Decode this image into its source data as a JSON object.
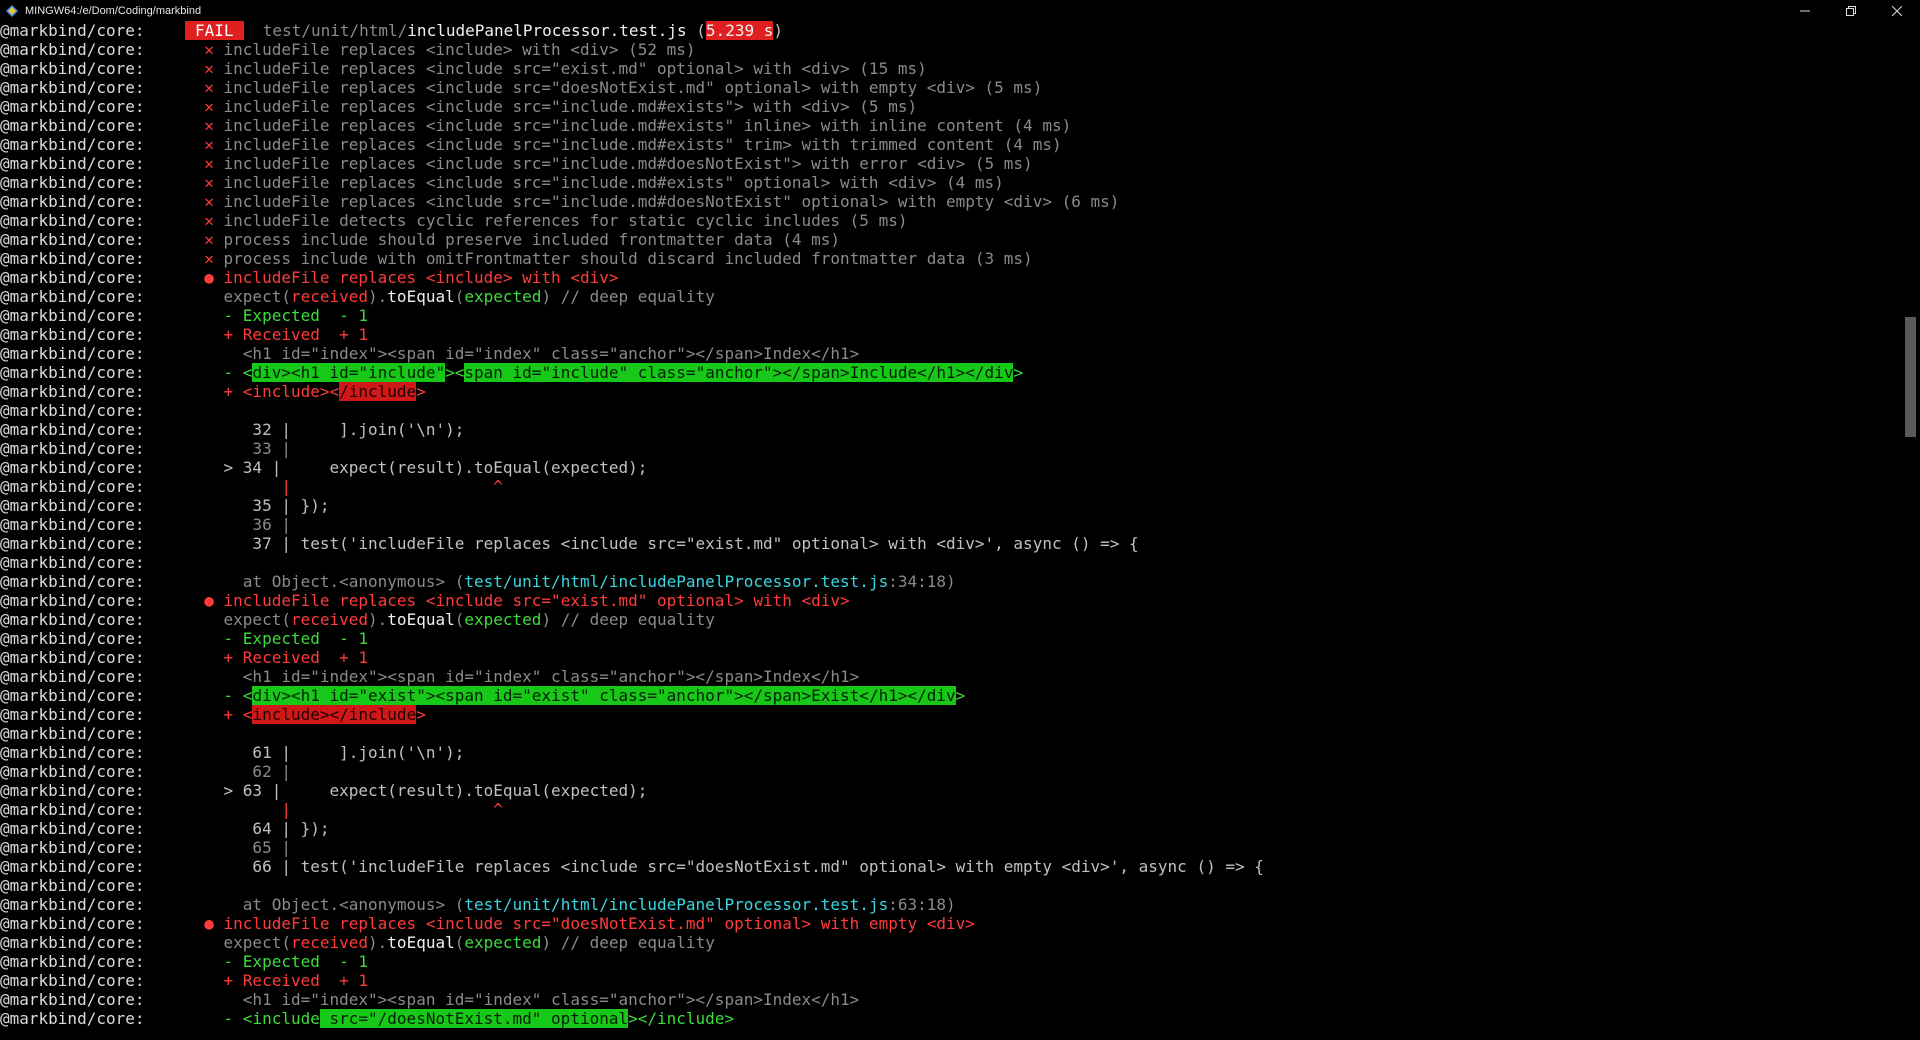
{
  "window": {
    "title": "MINGW64:/e/Dom/Coding/markbind"
  },
  "colors": {
    "default": "#c0c0c0",
    "dim": "#8a8a8a",
    "red": "#ff3b3b",
    "green": "#3ddc3d",
    "yellow": "#e8e84a",
    "cyan": "#3ad6e0",
    "white": "#f0f0f0",
    "badge_red": "#e02020",
    "hl_green": "#18c818",
    "hl_red": "#d01818"
  },
  "prefix": "@markbind/core:",
  "lines": [
    [
      [
        "FAIL",
        "badge"
      ],
      [
        "  test/unit/html/",
        "dim"
      ],
      [
        "includePanelProcessor.test.js",
        "white"
      ],
      [
        " (",
        "default"
      ],
      [
        "5.239 s",
        "redbadge"
      ],
      [
        ")",
        "default"
      ]
    ],
    [
      [
        "  ✕ ",
        "red"
      ],
      [
        "includeFile replaces <include> with <div> (52 ms)",
        "dim"
      ]
    ],
    [
      [
        "  ✕ ",
        "red"
      ],
      [
        "includeFile replaces <include src=\"exist.md\" optional> with <div> (15 ms)",
        "dim"
      ]
    ],
    [
      [
        "  ✕ ",
        "red"
      ],
      [
        "includeFile replaces <include src=\"doesNotExist.md\" optional> with empty <div> (5 ms)",
        "dim"
      ]
    ],
    [
      [
        "  ✕ ",
        "red"
      ],
      [
        "includeFile replaces <include src=\"include.md#exists\"> with <div> (5 ms)",
        "dim"
      ]
    ],
    [
      [
        "  ✕ ",
        "red"
      ],
      [
        "includeFile replaces <include src=\"include.md#exists\" inline> with inline content (4 ms)",
        "dim"
      ]
    ],
    [
      [
        "  ✕ ",
        "red"
      ],
      [
        "includeFile replaces <include src=\"include.md#exists\" trim> with trimmed content (4 ms)",
        "dim"
      ]
    ],
    [
      [
        "  ✕ ",
        "red"
      ],
      [
        "includeFile replaces <include src=\"include.md#doesNotExist\"> with error <div> (5 ms)",
        "dim"
      ]
    ],
    [
      [
        "  ✕ ",
        "red"
      ],
      [
        "includeFile replaces <include src=\"include.md#exists\" optional> with <div> (4 ms)",
        "dim"
      ]
    ],
    [
      [
        "  ✕ ",
        "red"
      ],
      [
        "includeFile replaces <include src=\"include.md#doesNotExist\" optional> with empty <div> (6 ms)",
        "dim"
      ]
    ],
    [
      [
        "  ✕ ",
        "red"
      ],
      [
        "includeFile detects cyclic references for static cyclic includes (5 ms)",
        "dim"
      ]
    ],
    [
      [
        "  ✕ ",
        "red"
      ],
      [
        "process include should preserve included frontmatter data (4 ms)",
        "dim"
      ]
    ],
    [
      [
        "  ✕ ",
        "red"
      ],
      [
        "process include with omitFrontmatter should discard included frontmatter data (3 ms)",
        "dim"
      ]
    ],
    [
      [
        "  ● ",
        "red"
      ],
      [
        "includeFile replaces <include> with <div>",
        "red"
      ]
    ],
    [
      [
        "    expect(",
        "dim"
      ],
      [
        "received",
        "red"
      ],
      [
        ").",
        "dim"
      ],
      [
        "toEqual",
        "white"
      ],
      [
        "(",
        "dim"
      ],
      [
        "expected",
        "green"
      ],
      [
        ") // deep equality",
        "dim"
      ]
    ],
    [
      [
        "    - Expected  - 1",
        "green"
      ]
    ],
    [
      [
        "    + Received  + 1",
        "red"
      ]
    ],
    [
      [
        "      <h1 id=\"index\"><span id=\"index\" class=\"anchor\"></span>Index</h1>",
        "dim"
      ]
    ],
    [
      [
        "    - <",
        "green"
      ],
      [
        "div><h1 id=\"",
        "hlg"
      ],
      [
        "include",
        "hlg"
      ],
      [
        "\"",
        "hlg"
      ],
      [
        "><",
        "green"
      ],
      [
        "span id=\"include\" class=\"anchor\"></span>Include</h1></div",
        "hlg"
      ],
      [
        ">",
        "green"
      ]
    ],
    [
      [
        "    + <include><",
        "red"
      ],
      [
        "/include",
        "hlr"
      ],
      [
        ">",
        "red"
      ]
    ],
    [
      [
        "",
        "default"
      ]
    ],
    [
      [
        "       32 |     ].join('\\n');",
        "default"
      ]
    ],
    [
      [
        "       33 |",
        "dim"
      ]
    ],
    [
      [
        "    > 34 |     expect(result).toEqual(expected);",
        "default"
      ]
    ],
    [
      [
        "          |                     ^",
        "red"
      ]
    ],
    [
      [
        "       35 | });",
        "default"
      ]
    ],
    [
      [
        "       36 |",
        "dim"
      ]
    ],
    [
      [
        "       37 | test('includeFile replaces <include src=\"exist.md\" optional> with <div>', async () => {",
        "default"
      ]
    ],
    [
      [
        "",
        "default"
      ]
    ],
    [
      [
        "      at Object.<anonymous> (",
        "dim"
      ],
      [
        "test/unit/html/includePanelProcessor.test.js",
        "cyan"
      ],
      [
        ":34:18)",
        "dim"
      ]
    ],
    [
      [
        "  ● ",
        "red"
      ],
      [
        "includeFile replaces <include src=\"exist.md\" optional> with <div>",
        "red"
      ]
    ],
    [
      [
        "    expect(",
        "dim"
      ],
      [
        "received",
        "red"
      ],
      [
        ").",
        "dim"
      ],
      [
        "toEqual",
        "white"
      ],
      [
        "(",
        "dim"
      ],
      [
        "expected",
        "green"
      ],
      [
        ") // deep equality",
        "dim"
      ]
    ],
    [
      [
        "    - Expected  - 1",
        "green"
      ]
    ],
    [
      [
        "    + Received  + 1",
        "red"
      ]
    ],
    [
      [
        "      <h1 id=\"index\"><span id=\"index\" class=\"anchor\"></span>Index</h1>",
        "dim"
      ]
    ],
    [
      [
        "    - <",
        "green"
      ],
      [
        "div><h1 id=\"exist\"><span id=\"exist\" class=\"anchor\"></span>Exist</h1></div",
        "hlg"
      ],
      [
        ">",
        "green"
      ]
    ],
    [
      [
        "    + <",
        "red"
      ],
      [
        "include></include",
        "hlr"
      ],
      [
        ">",
        "red"
      ]
    ],
    [
      [
        "",
        "default"
      ]
    ],
    [
      [
        "       61 |     ].join('\\n');",
        "default"
      ]
    ],
    [
      [
        "       62 |",
        "dim"
      ]
    ],
    [
      [
        "    > 63 |     expect(result).toEqual(expected);",
        "default"
      ]
    ],
    [
      [
        "          |                     ^",
        "red"
      ]
    ],
    [
      [
        "       64 | });",
        "default"
      ]
    ],
    [
      [
        "       65 |",
        "dim"
      ]
    ],
    [
      [
        "       66 | test('includeFile replaces <include src=\"doesNotExist.md\" optional> with empty <div>', async () => {",
        "default"
      ]
    ],
    [
      [
        "",
        "default"
      ]
    ],
    [
      [
        "      at Object.<anonymous> (",
        "dim"
      ],
      [
        "test/unit/html/includePanelProcessor.test.js",
        "cyan"
      ],
      [
        ":63:18)",
        "dim"
      ]
    ],
    [
      [
        "  ● ",
        "red"
      ],
      [
        "includeFile replaces <include src=\"doesNotExist.md\" optional> with empty <div>",
        "red"
      ]
    ],
    [
      [
        "    expect(",
        "dim"
      ],
      [
        "received",
        "red"
      ],
      [
        ").",
        "dim"
      ],
      [
        "toEqual",
        "white"
      ],
      [
        "(",
        "dim"
      ],
      [
        "expected",
        "green"
      ],
      [
        ") // deep equality",
        "dim"
      ]
    ],
    [
      [
        "    - Expected  - 1",
        "green"
      ]
    ],
    [
      [
        "    + Received  + 1",
        "red"
      ]
    ],
    [
      [
        "      <h1 id=\"index\"><span id=\"index\" class=\"anchor\"></span>Index</h1>",
        "dim"
      ]
    ],
    [
      [
        "    - <include",
        "green"
      ],
      [
        " src=\"/doesNotExist.md\" optional",
        "hlg"
      ],
      [
        "></include>",
        "green"
      ]
    ]
  ]
}
